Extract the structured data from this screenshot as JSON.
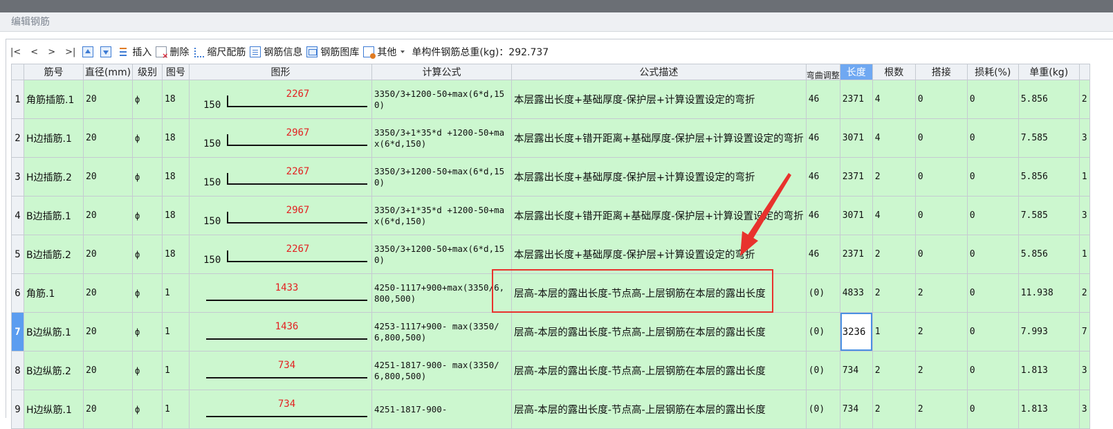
{
  "window": {
    "title": "编辑钢筋"
  },
  "toolbar": {
    "nav_first": "|<",
    "nav_prev": "<",
    "nav_next": ">",
    "nav_last": ">|",
    "insert": "插入",
    "delete": "删除",
    "scale": "缩尺配筋",
    "info": "钢筋信息",
    "library": "钢筋图库",
    "other": "其他",
    "total": "单构件钢筋总重(kg)：292.737"
  },
  "table": {
    "columns": [
      "筋号",
      "直径(mm)",
      "级别",
      "图号",
      "图形",
      "计算公式",
      "公式描述",
      "弯曲调整",
      "长度",
      "根数",
      "搭接",
      "损耗(%)",
      "单重(kg)",
      ""
    ],
    "rows": [
      {
        "idx": "1",
        "name": "角筋插筋.1",
        "dia": "20",
        "grade": "ф",
        "fig": "18",
        "hook": "150",
        "shape_len": "2267",
        "formula": "3350/3+1200-50+max(6*d,150)",
        "desc": "本层露出长度+基础厚度-保护层+计算设置设定的弯折",
        "bend": "46",
        "length": "2371",
        "count": "4",
        "lap": "0",
        "loss": "0",
        "weight": "5.856",
        "extra": "2"
      },
      {
        "idx": "2",
        "name": "H边插筋.1",
        "dia": "20",
        "grade": "ф",
        "fig": "18",
        "hook": "150",
        "shape_len": "2967",
        "formula": "3350/3+1*35*d +1200-50+max(6*d,150)",
        "desc": "本层露出长度+错开距离+基础厚度-保护层+计算设置设定的弯折",
        "bend": "46",
        "length": "3071",
        "count": "4",
        "lap": "0",
        "loss": "0",
        "weight": "7.585",
        "extra": "3"
      },
      {
        "idx": "3",
        "name": "H边插筋.2",
        "dia": "20",
        "grade": "ф",
        "fig": "18",
        "hook": "150",
        "shape_len": "2267",
        "formula": "3350/3+1200-50+max(6*d,150)",
        "desc": "本层露出长度+基础厚度-保护层+计算设置设定的弯折",
        "bend": "46",
        "length": "2371",
        "count": "2",
        "lap": "0",
        "loss": "0",
        "weight": "5.856",
        "extra": "1"
      },
      {
        "idx": "4",
        "name": "B边插筋.1",
        "dia": "20",
        "grade": "ф",
        "fig": "18",
        "hook": "150",
        "shape_len": "2967",
        "formula": "3350/3+1*35*d +1200-50+max(6*d,150)",
        "desc": "本层露出长度+错开距离+基础厚度-保护层+计算设置设定的弯折",
        "bend": "46",
        "length": "3071",
        "count": "4",
        "lap": "0",
        "loss": "0",
        "weight": "7.585",
        "extra": "3"
      },
      {
        "idx": "5",
        "name": "B边插筋.2",
        "dia": "20",
        "grade": "ф",
        "fig": "18",
        "hook": "150",
        "shape_len": "2267",
        "formula": "3350/3+1200-50+max(6*d,150)",
        "desc": "本层露出长度+基础厚度-保护层+计算设置设定的弯折",
        "bend": "46",
        "length": "2371",
        "count": "2",
        "lap": "0",
        "loss": "0",
        "weight": "5.856",
        "extra": "1"
      },
      {
        "idx": "6",
        "name": "角筋.1",
        "dia": "20",
        "grade": "ф",
        "fig": "1",
        "hook": "",
        "shape_len": "1433",
        "formula": "4250-1117+900+max(3350/6,800,500)",
        "desc": "层高-本层的露出长度-节点高-上层钢筋在本层的露出长度",
        "bend": "(0)",
        "length": "4833",
        "count": "2",
        "lap": "2",
        "loss": "0",
        "weight": "11.938",
        "extra": "2"
      },
      {
        "idx": "7",
        "name": "B边纵筋.1",
        "dia": "20",
        "grade": "ф",
        "fig": "1",
        "hook": "",
        "shape_len": "1436",
        "formula": "4253-1117+900- max(3350/6,800,500)",
        "desc": "层高-本层的露出长度-节点高-上层钢筋在本层的露出长度",
        "bend": "(0)",
        "length": "3236",
        "count": "1",
        "lap": "2",
        "loss": "0",
        "weight": "7.993",
        "extra": "7"
      },
      {
        "idx": "8",
        "name": "B边纵筋.2",
        "dia": "20",
        "grade": "ф",
        "fig": "1",
        "hook": "",
        "shape_len": "734",
        "formula": "4251-1817-900- max(3350/6,800,500)",
        "desc": "层高-本层的露出长度-节点高-上层钢筋在本层的露出长度",
        "bend": "(0)",
        "length": "734",
        "count": "2",
        "lap": "2",
        "loss": "0",
        "weight": "1.813",
        "extra": "3"
      },
      {
        "idx": "9",
        "name": "H边纵筋.1",
        "dia": "20",
        "grade": "ф",
        "fig": "1",
        "hook": "",
        "shape_len": "734",
        "formula": "4251-1817-900-",
        "desc": "层高-本层的露出长度-节点高-上层钢筋在本层的露出长度",
        "bend": "(0)",
        "length": "734",
        "count": "2",
        "lap": "2",
        "loss": "0",
        "weight": "1.813",
        "extra": "3"
      }
    ]
  },
  "colors": {
    "row_bg": "#ccf7cf",
    "header_bg": "#eef1f5",
    "active_header": "#6fa8f2",
    "shape_length": "#e32020",
    "annotation": "#e8322d"
  }
}
